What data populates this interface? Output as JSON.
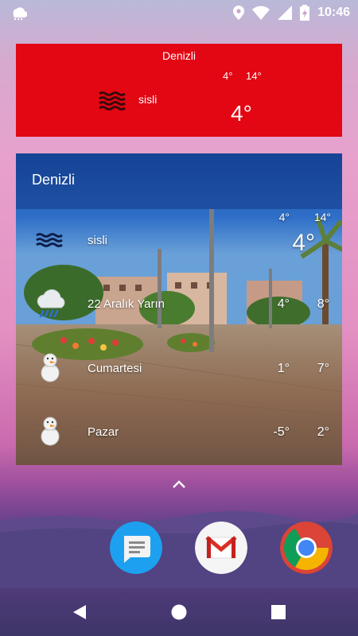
{
  "status_bar": {
    "time": "10:46",
    "icons": [
      "weather-cloud-icon",
      "location-icon",
      "wifi-icon",
      "battery-charging-icon"
    ]
  },
  "red_widget": {
    "city": "Denizli",
    "condition": "sisli",
    "low": "4°",
    "high": "14°",
    "current": "4°",
    "background_color": "#e30613",
    "icon": "fog-icon"
  },
  "big_widget": {
    "city": "Denizli",
    "current": {
      "condition": "sisli",
      "low": "4°",
      "high": "14°",
      "current": "4°",
      "icon": "fog-icon"
    },
    "forecast": [
      {
        "label": "22 Aralık Yarın",
        "low": "4°",
        "high": "8°",
        "icon": "rain-cloud-icon"
      },
      {
        "label": "Cumartesi",
        "low": "1°",
        "high": "7°",
        "icon": "snowman-icon"
      },
      {
        "label": "Pazar",
        "low": "-5°",
        "high": "2°",
        "icon": "snowman-icon"
      }
    ]
  },
  "dock": {
    "apps": [
      "messages-app-icon",
      "gmail-app-icon",
      "chrome-app-icon"
    ]
  },
  "nav": {
    "buttons": [
      "back-button",
      "home-button",
      "recents-button"
    ]
  }
}
